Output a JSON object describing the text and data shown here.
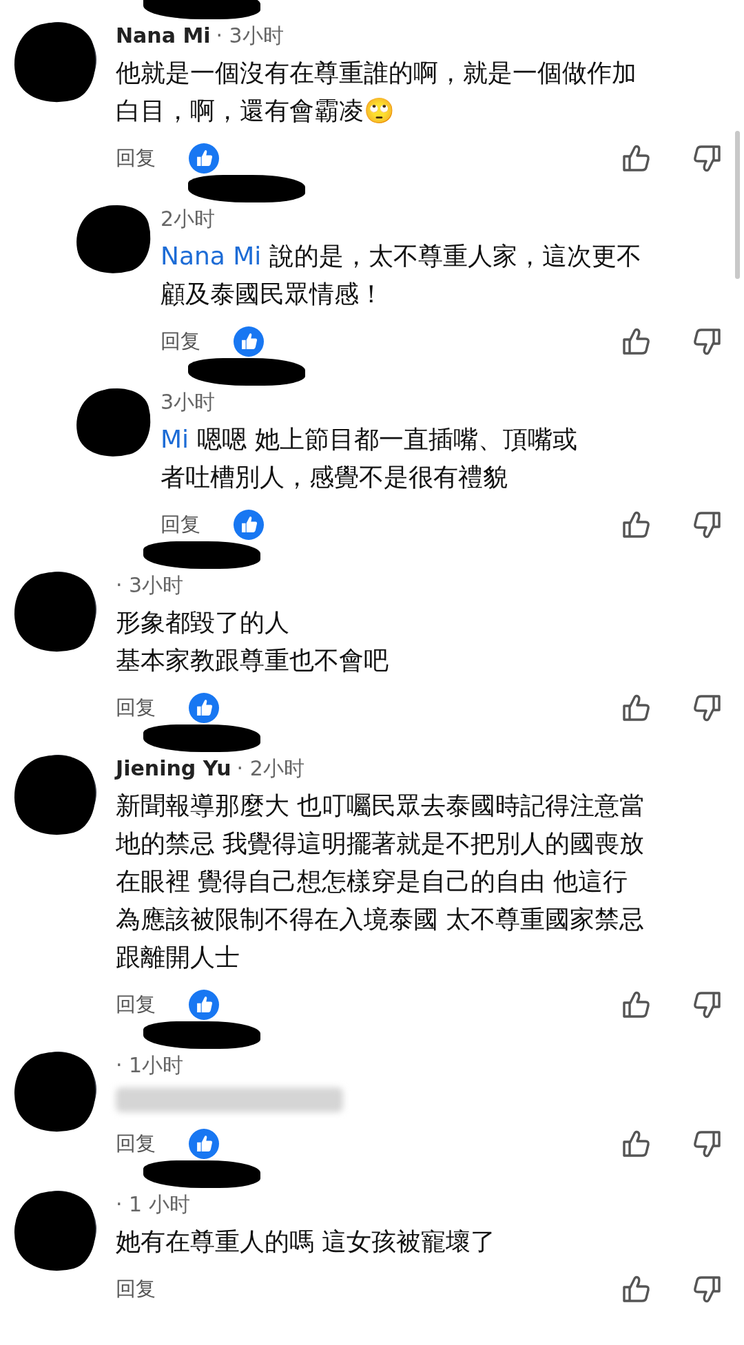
{
  "comments": [
    {
      "name": "Nana Mi",
      "time": "· 3小时",
      "redacted": true,
      "lines": [
        "他就是一個沒有在尊重誰的啊，就是一個做作加",
        "白目，啊，還有會霸凌🙄"
      ],
      "reply_label": "回复",
      "reacted": true,
      "replies": [
        {
          "time": "2小时",
          "redacted": true,
          "mention": "Nana Mi",
          "lines": [
            "說的是，太不尊重人家，這次更不",
            "顧及泰國民眾情感！"
          ],
          "reply_label": "回复",
          "reacted": true
        },
        {
          "time": "3小时",
          "redacted": true,
          "mention": "Mi",
          "lines": [
            "嗯嗯 她上節目都一直插嘴、頂嘴或",
            "者吐槽別人，感覺不是很有禮貌"
          ],
          "reply_label": "回复",
          "reacted": true
        }
      ]
    },
    {
      "time": "· 3小时",
      "redacted": true,
      "lines": [
        "形象都毀了的人",
        "基本家教跟尊重也不會吧"
      ],
      "reply_label": "回复",
      "reacted": true
    },
    {
      "name": "Jiening Yu",
      "time": "· 2小时",
      "redacted": true,
      "lines": [
        "新聞報導那麼大 也叮囑民眾去泰國時記得注意當",
        "地的禁忌 我覺得這明擺著就是不把別人的國喪放",
        "在眼裡 覺得自己想怎樣穿是自己的自由 他這行",
        "為應該被限制不得在入境泰國 太不尊重國家禁忌",
        "跟離開人士"
      ],
      "reply_label": "回复",
      "reacted": true
    },
    {
      "time": "· 1小时",
      "redacted": true,
      "blurred": true,
      "reply_label": "回复",
      "reacted": true
    },
    {
      "time": "· 1 小时",
      "redacted": true,
      "lines": [
        "她有在尊重人的嗎 這女孩被寵壞了"
      ],
      "reply_label": "回复",
      "reacted": false
    }
  ]
}
